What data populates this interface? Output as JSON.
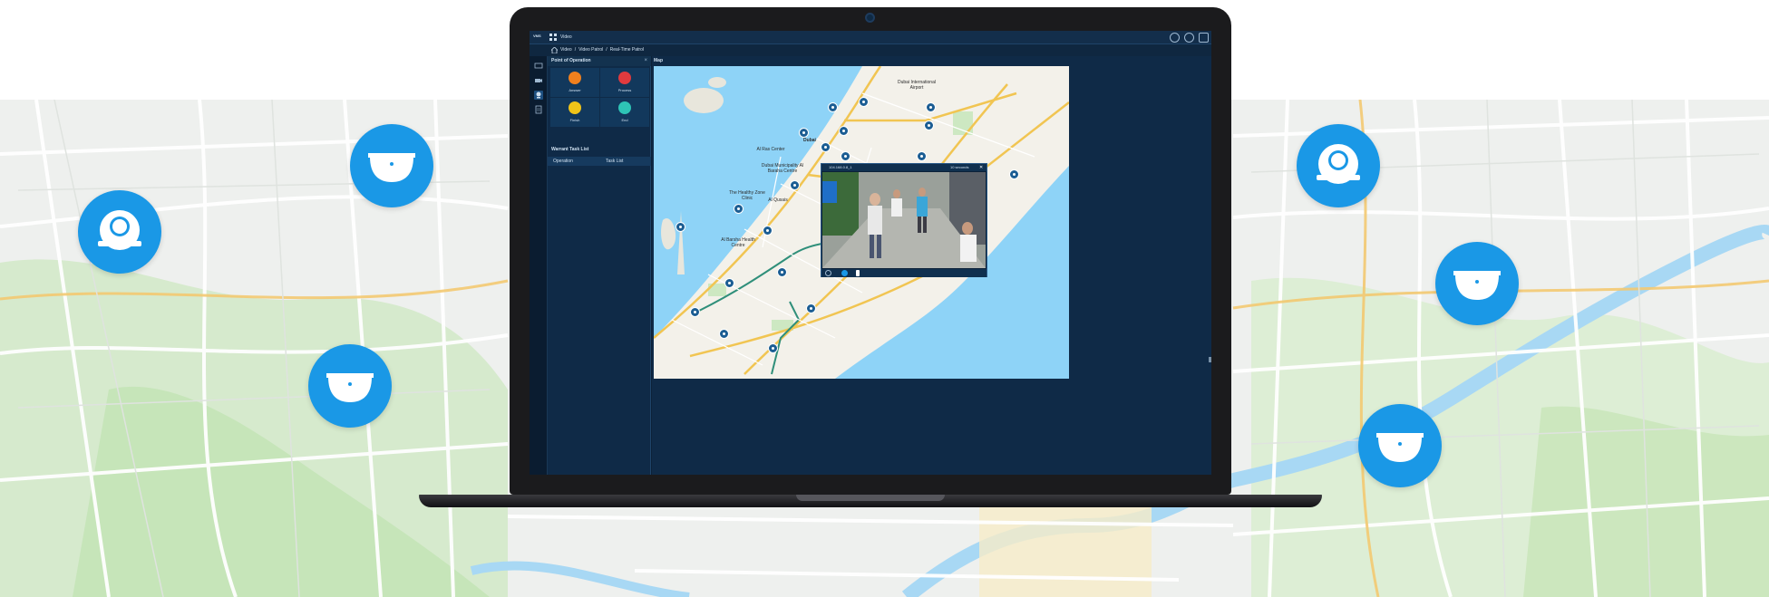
{
  "app": {
    "logo_text": "VMS",
    "title": "Video",
    "breadcrumb": [
      "Video",
      "/",
      "Video Patrol",
      "/",
      "Real-Time Patrol"
    ]
  },
  "side_panel": {
    "point_of_operation_title": "Point of Operation",
    "close_glyph": "×",
    "operations": [
      {
        "label": "Answer",
        "color": "#f0801e"
      },
      {
        "label": "Process",
        "color": "#e03a3e"
      },
      {
        "label": "Finish",
        "color": "#f0c419"
      },
      {
        "label": "End",
        "color": "#2ec4b6"
      }
    ],
    "task_list_title": "Warrant Task List",
    "task_columns": [
      "Operation",
      "Task List"
    ]
  },
  "map": {
    "title": "Map",
    "labels": [
      {
        "text": "Dubai International Airport"
      },
      {
        "text": "Al Ras Center"
      },
      {
        "text": "Dubai Municipality Al Baraha Centre"
      },
      {
        "text": "The Healthy Zone Clinic"
      },
      {
        "text": "Al Qusais"
      },
      {
        "text": "Al Barsha Health Centre"
      },
      {
        "text": "Dubai"
      }
    ]
  },
  "video_popup": {
    "title": "104.168.0.8_1",
    "status": "10 seconds",
    "close_glyph": "✕"
  },
  "colors": {
    "accent": "#1a98e6",
    "screen_bg": "#0c2138",
    "map_water": "#8ed3f7"
  }
}
